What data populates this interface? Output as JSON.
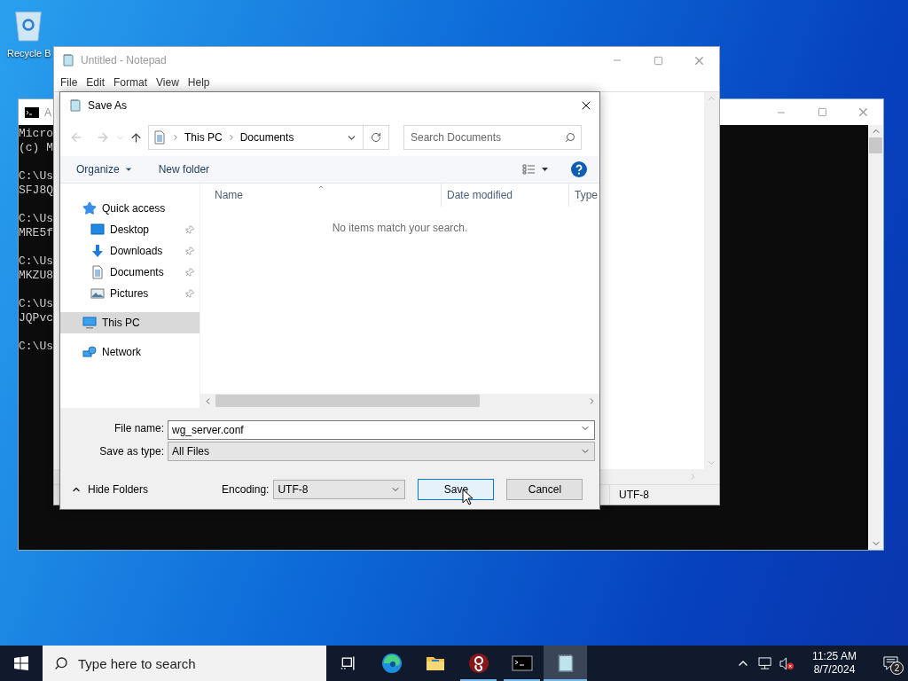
{
  "desktop_icons": [
    {
      "label": "Recycle B"
    }
  ],
  "console_window": {
    "title": "A",
    "blocks": [
      [
        "Micro",
        "(c) M"
      ],
      [
        "C:\\Us",
        "SFJ8Q"
      ],
      [
        "C:\\Us",
        "MRE5f"
      ],
      [
        "C:\\Us",
        "MKZU8"
      ],
      [
        "C:\\Us",
        "JQPvc"
      ],
      [
        "C:\\Us"
      ]
    ]
  },
  "notepad": {
    "title": "Untitled - Notepad",
    "active": false,
    "menu": [
      "File",
      "Edit",
      "Format",
      "View",
      "Help"
    ],
    "status": {
      "encoding": "UTF-8"
    }
  },
  "save_dialog": {
    "title": "Save As",
    "nav": {
      "back_enabled": false,
      "forward_enabled": false
    },
    "breadcrumb": [
      "This PC",
      "Documents"
    ],
    "search": {
      "placeholder": "Search Documents"
    },
    "toolbar": {
      "organize": "Organize",
      "new_folder": "New folder"
    },
    "sidebar": {
      "items": [
        {
          "label": "Quick access",
          "kind": "star",
          "selected": false,
          "children": [
            {
              "label": "Desktop",
              "kind": "desktop",
              "pinned": true,
              "selected": false
            },
            {
              "label": "Downloads",
              "kind": "downloads",
              "pinned": true,
              "selected": false
            },
            {
              "label": "Documents",
              "kind": "documents",
              "pinned": true,
              "selected": false
            },
            {
              "label": "Pictures",
              "kind": "pictures",
              "pinned": true,
              "selected": false
            }
          ]
        },
        {
          "label": "This PC",
          "kind": "pc",
          "selected": true
        },
        {
          "label": "Network",
          "kind": "network",
          "selected": false
        }
      ]
    },
    "columns": [
      {
        "label": "Name",
        "sorted": true
      },
      {
        "label": "Date modified",
        "sorted": false
      },
      {
        "label": "Type",
        "sorted": false
      }
    ],
    "empty_message": "No items match your search.",
    "file_name": {
      "label": "File name:",
      "value": "wg_server.conf"
    },
    "save_as_type": {
      "label": "Save as type:",
      "value": "All Files"
    },
    "hide_folders": "Hide Folders",
    "encoding": {
      "label": "Encoding:",
      "value": "UTF-8"
    },
    "buttons": [
      {
        "label": "Save",
        "default": true
      },
      {
        "label": "Cancel",
        "default": false
      }
    ]
  },
  "taskbar": {
    "search": {
      "placeholder": "Type here to search"
    },
    "apps": [
      {
        "kind": "taskview",
        "running": false,
        "selected": false
      },
      {
        "kind": "edge",
        "running": false,
        "selected": false
      },
      {
        "kind": "explorer",
        "running": false,
        "selected": false
      },
      {
        "kind": "wireguard",
        "running": true,
        "selected": false
      },
      {
        "kind": "console",
        "running": true,
        "selected": false
      },
      {
        "kind": "notepad",
        "running": true,
        "selected": true
      }
    ],
    "tray": {
      "time": "11:25 AM",
      "date": "8/7/2024",
      "notifications": "2"
    }
  }
}
